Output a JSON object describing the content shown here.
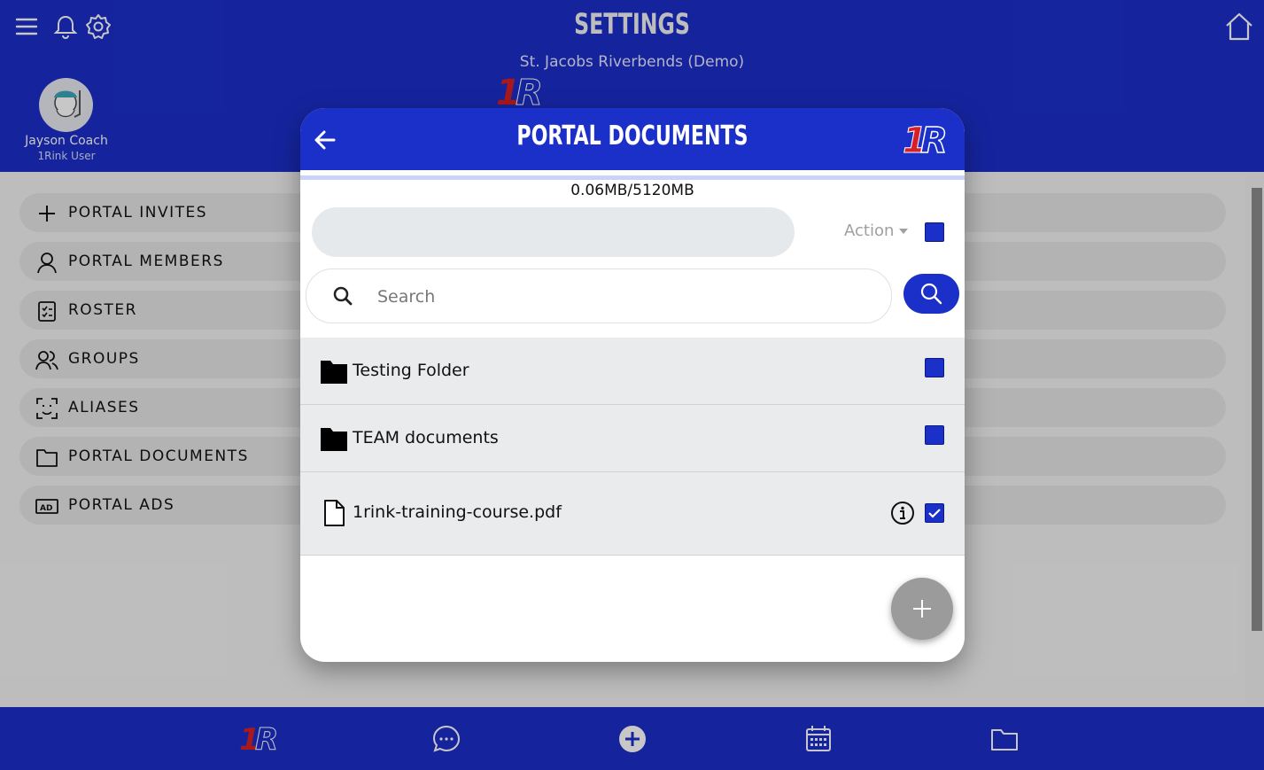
{
  "header": {
    "title": "SETTINGS",
    "subtitle": "St. Jacobs Riverbends (Demo)",
    "user_name": "Jayson Coach",
    "user_role": "1Rink User"
  },
  "menu": [
    {
      "label": "PORTAL INVITES",
      "icon": "plus-icon"
    },
    {
      "label": "PORTAL MEMBERS",
      "icon": "member-icon"
    },
    {
      "label": "ROSTER",
      "icon": "roster-icon"
    },
    {
      "label": "GROUPS",
      "icon": "groups-icon"
    },
    {
      "label": "ALIASES",
      "icon": "alias-icon"
    },
    {
      "label": "PORTAL DOCUMENTS",
      "icon": "folder-icon"
    },
    {
      "label": "PORTAL ADS",
      "icon": "ad-icon"
    }
  ],
  "modal": {
    "title": "PORTAL DOCUMENTS",
    "storage": "0.06MB/5120MB",
    "action_label": "Action",
    "search_placeholder": "Search",
    "items": [
      {
        "name": "Testing Folder",
        "type": "folder",
        "checked": false
      },
      {
        "name": "TEAM documents",
        "type": "folder",
        "checked": false
      },
      {
        "name": "1rink-training-course.pdf",
        "type": "file",
        "checked": true
      }
    ]
  },
  "bottom_nav": [
    "logo-icon",
    "chat-icon",
    "add-circle-icon",
    "calendar-icon",
    "folder-icon"
  ],
  "colors": {
    "brand": "#1b2fc9",
    "accent_red": "#d81f26"
  }
}
